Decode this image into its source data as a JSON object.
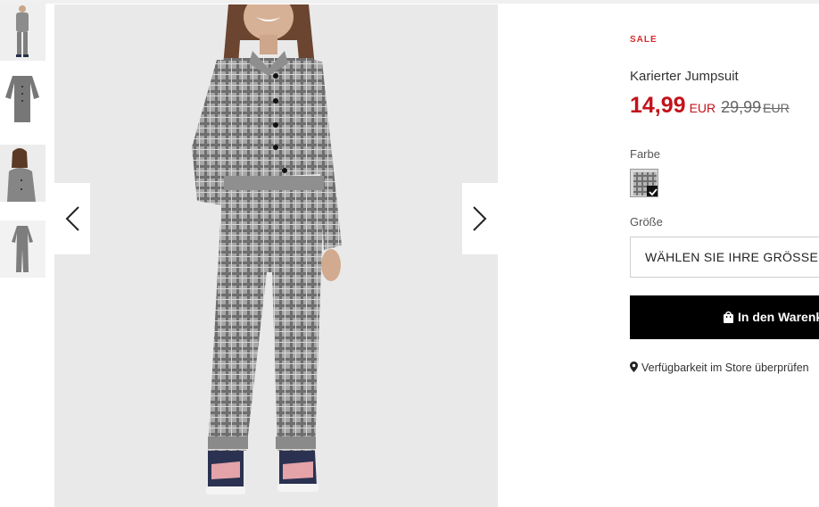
{
  "thumbnails": [
    {
      "name": "thumb-full-front"
    },
    {
      "name": "thumb-flat-lay"
    },
    {
      "name": "thumb-upper-body"
    },
    {
      "name": "thumb-back"
    }
  ],
  "gallery": {
    "prev_icon": "chevron-left-icon",
    "next_icon": "chevron-right-icon"
  },
  "product": {
    "sale_label": "SALE",
    "title": "Karierter Jumpsuit",
    "price_current": "14,99",
    "price_current_currency": "EUR",
    "price_old": "29,99",
    "price_old_currency": "EUR"
  },
  "color": {
    "label": "Farbe",
    "selected": true
  },
  "size": {
    "label": "Größe",
    "placeholder": "WÄHLEN SIE IHRE GRÖSSE"
  },
  "cart": {
    "button_label": "In den Warenkorb",
    "icon": "shopping-bag-icon"
  },
  "store": {
    "icon": "map-pin-icon",
    "link_label": "Verfügbarkeit im Store überprüfen"
  },
  "colors": {
    "sale_red": "#c4121a",
    "button_black": "#000000",
    "image_bg": "#e9e9e9"
  }
}
